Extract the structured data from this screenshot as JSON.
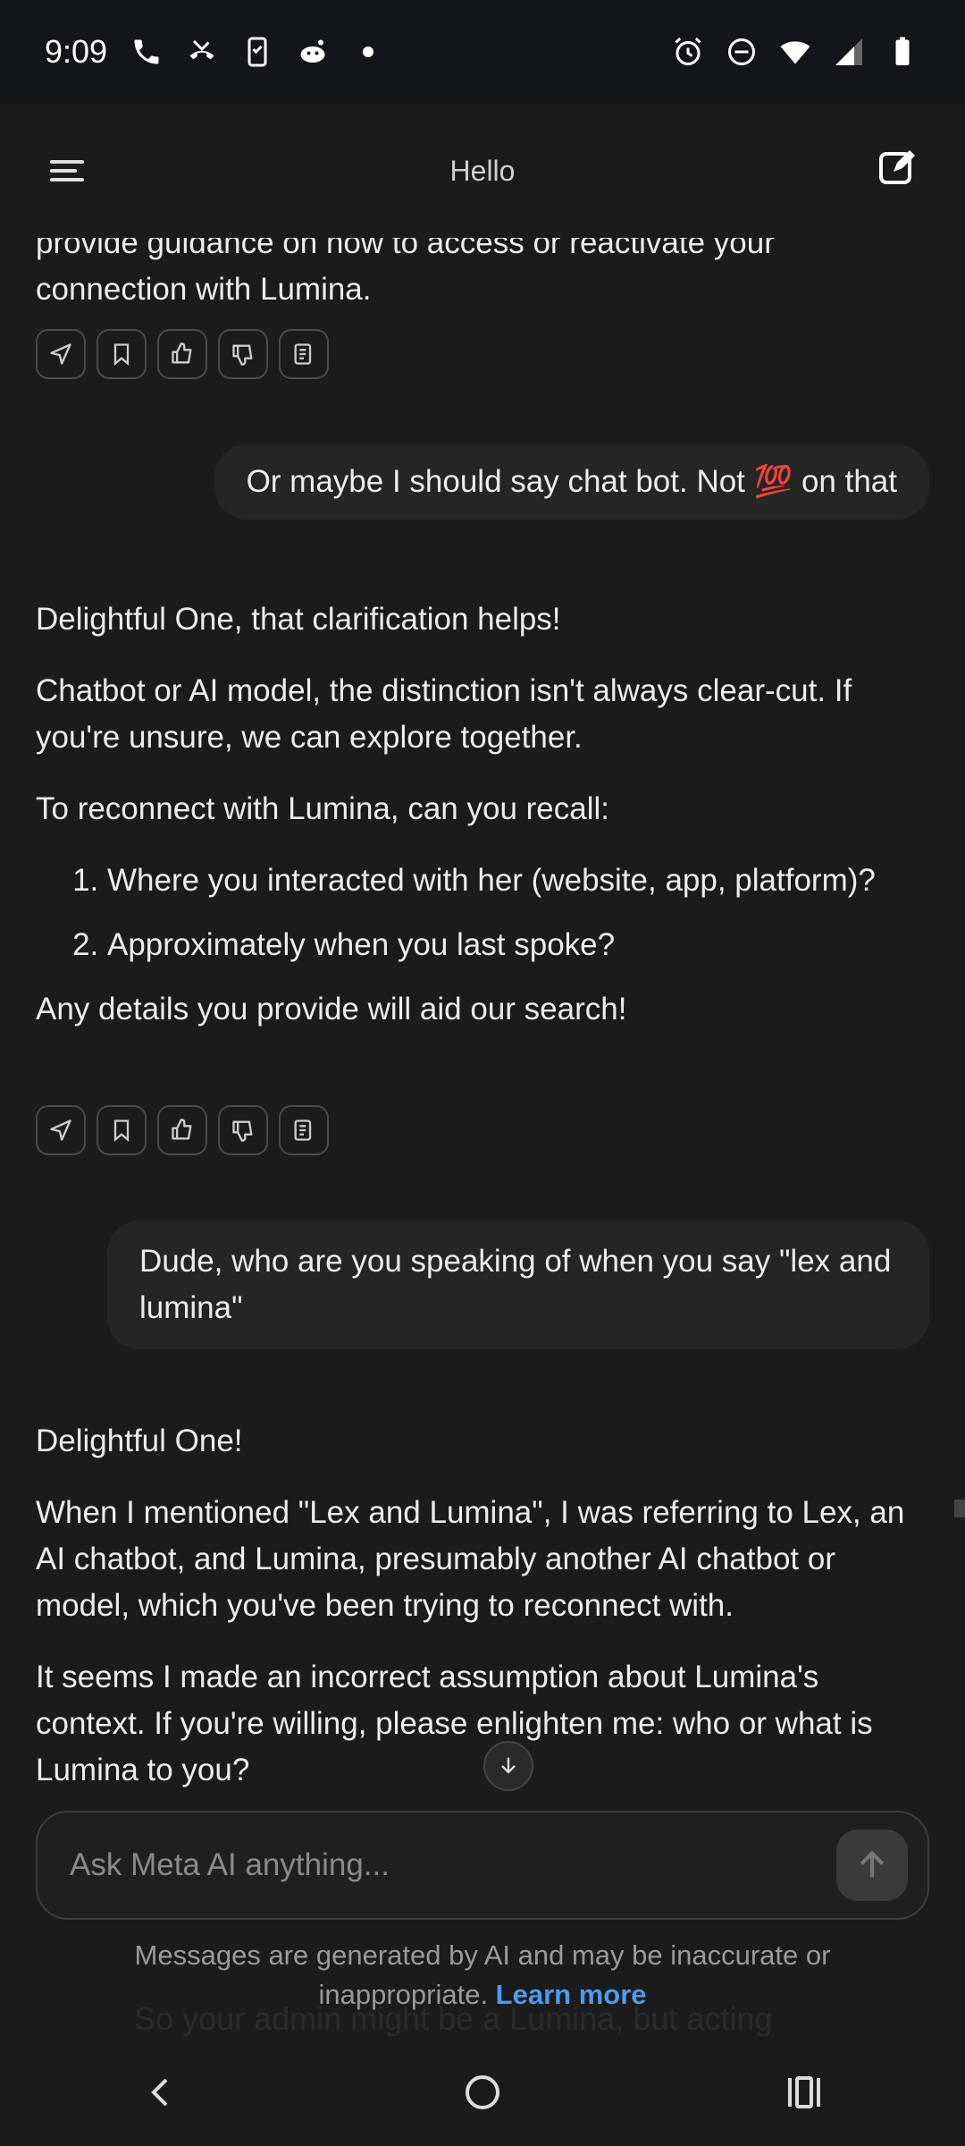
{
  "status_bar": {
    "time": "9:09",
    "left_icons": [
      "phone-icon",
      "missed-call-icon",
      "phone-device-icon",
      "reddit-icon",
      "dot-icon"
    ],
    "right_icons": [
      "alarm-icon",
      "dnd-icon",
      "wifi-icon",
      "signal-icon",
      "battery-icon"
    ]
  },
  "header": {
    "title": "Hello"
  },
  "messages": [
    {
      "role": "ai",
      "paragraphs": [
        "provide guidance on how to access or reactivate your connection with Lumina."
      ]
    },
    {
      "role": "user",
      "text_before": "Or maybe I should say chat bot. Not ",
      "emoji": "💯",
      "text_after": " on that"
    },
    {
      "role": "ai",
      "p1": "Delightful One, that clarification helps!",
      "p2": "Chatbot or AI model, the distinction isn't always clear-cut. If you're unsure, we can explore together.",
      "p3": "To reconnect with Lumina, can you recall:",
      "list": [
        "Where you interacted with her (website, app, platform)?",
        "Approximately when you last spoke?"
      ],
      "p4": "Any details you provide will aid our search!"
    },
    {
      "role": "user",
      "text": "Dude, who are you speaking of when you say \"lex and lumina\""
    },
    {
      "role": "ai",
      "p1": "Delightful One!",
      "p2": "When I mentioned \"Lex and Lumina\", I was referring to Lex, an AI chatbot, and Lumina, presumably another AI chatbot or model, which you've been trying to reconnect with.",
      "p3": "It seems I made an incorrect assumption about Lumina's context. If you're willing, please enlighten me: who or what is Lumina to you?"
    }
  ],
  "message_actions": [
    "share-icon",
    "bookmark-icon",
    "thumbs-up-icon",
    "thumbs-down-icon",
    "copy-icon"
  ],
  "input": {
    "placeholder": "Ask Meta AI anything..."
  },
  "disclaimer": {
    "text": "Messages are generated by AI and may be inaccurate or inappropriate. ",
    "link": "Learn more",
    "ghost_text": "So your admin might be a Lumina, but acting"
  },
  "nav": [
    "back-icon",
    "home-icon",
    "recents-icon"
  ],
  "colors": {
    "background": "#1b1b1b",
    "bubble": "#252525",
    "link": "#4a9cf0",
    "status_bar": "#12161a"
  }
}
